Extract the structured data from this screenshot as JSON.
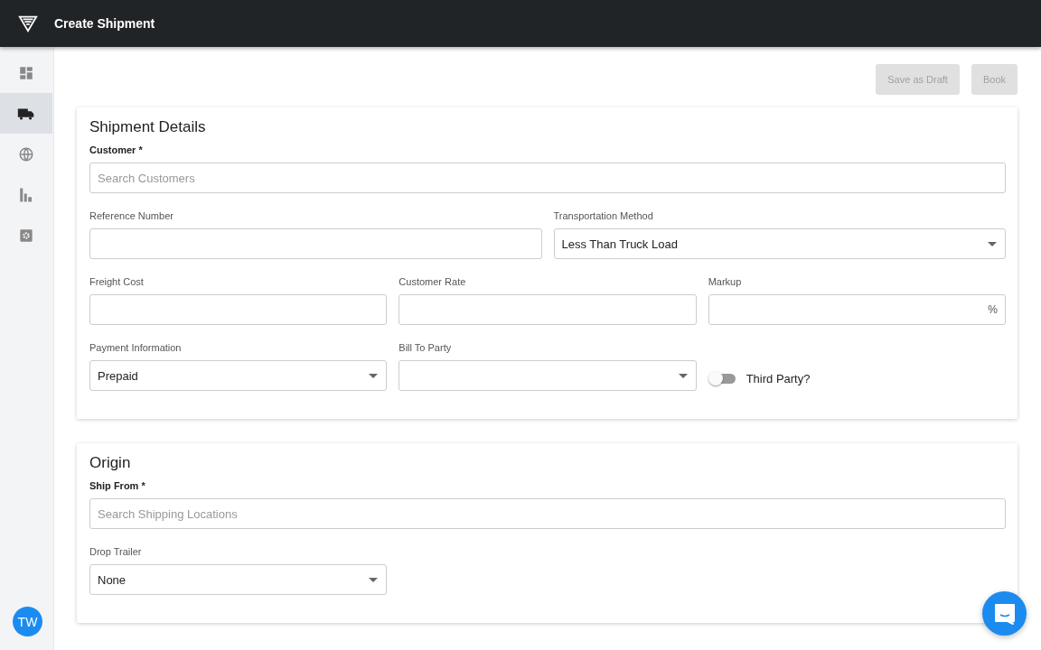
{
  "header": {
    "title": "Create Shipment"
  },
  "sidebar": {
    "items": [
      {
        "kind": "dashboard",
        "selected": false
      },
      {
        "kind": "truck",
        "selected": true
      },
      {
        "kind": "globe",
        "selected": false
      },
      {
        "kind": "chart",
        "selected": false
      },
      {
        "kind": "settings",
        "selected": false
      }
    ],
    "avatar": "TW"
  },
  "actions": [
    {
      "label": "Save as Draft",
      "disabled": true
    },
    {
      "label": "Book",
      "disabled": true
    }
  ],
  "sections": [
    {
      "title": "Shipment Details",
      "rows": [
        [
          {
            "kind": "search",
            "label": "Customer *",
            "required": true,
            "placeholder": "Search Customers"
          }
        ],
        [
          {
            "kind": "text",
            "label": "Reference Number",
            "required": false
          },
          {
            "kind": "select",
            "label": "Transportation Method",
            "required": false,
            "value": "Less Than Truck Load"
          }
        ],
        [
          {
            "kind": "text",
            "label": "Freight Cost",
            "required": false
          },
          {
            "kind": "text",
            "label": "Customer Rate",
            "required": false
          },
          {
            "kind": "text",
            "label": "Markup",
            "required": false,
            "suffix": "%"
          }
        ],
        [
          {
            "kind": "select",
            "label": "Payment Information",
            "required": false,
            "value": "Prepaid"
          },
          {
            "kind": "select",
            "label": "Bill To Party",
            "required": false
          },
          {
            "kind": "toggle",
            "label": "Third Party?",
            "on": false
          }
        ]
      ]
    },
    {
      "title": "Origin",
      "rows": [
        [
          {
            "kind": "search",
            "label": "Ship From *",
            "required": true,
            "placeholder": "Search Shipping Locations"
          }
        ],
        [
          {
            "kind": "select",
            "label": "Drop Trailer",
            "required": false,
            "value": "None"
          },
          {
            "kind": "empty"
          },
          {
            "kind": "empty"
          }
        ]
      ]
    }
  ]
}
